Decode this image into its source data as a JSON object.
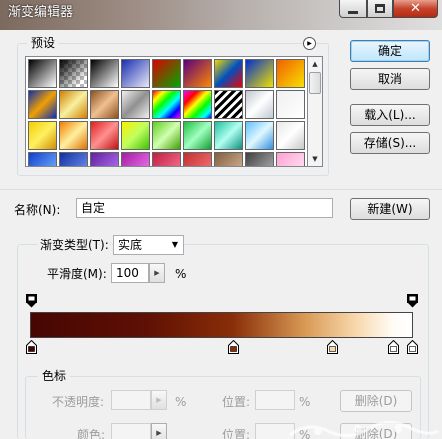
{
  "window": {
    "title": "渐变编辑器",
    "controls": {
      "minimize": "minimize",
      "maximize": "maximize",
      "close": "close"
    }
  },
  "presets": {
    "title": "预设",
    "menu_icon": "flyout-menu-icon",
    "swatches": [
      "#000,#fff",
      "checker",
      "#000,#fff",
      "#1a2fb0,#e8e8f8",
      "#d00,#0a0",
      "#5a0080,#f80",
      "#f0d800,#0050c0,#e00",
      "#0030d0,#f0e000",
      "#f06000,#f8e000",
      "#1030b0,#f0a000,#1030b0",
      "#d08000,#f8f0a0,#d08000",
      "#8c5020,#f0c090,#8c5020",
      "#f0f0f0,#909090,#f0f0f0",
      "rainbow",
      "rainbow2",
      "stripes",
      "#c0c8d0,#fff,#c0c8d0",
      "#f0f0f0,#fff",
      "#f0d000,#fff060,#d09000",
      "#f08000,#fff0a0,#e07000",
      "#e02020,#ff9090,#c01010",
      "#f8f000,#c0ff60,#40c000",
      "#60d020,#d0ffb0,#40a000",
      "#20c040,#a0ffc0,#10a030",
      "#20c0a0,#b0fff0,#109080",
      "#60c0ff,#e0f8ff,#3090e0",
      "#e8e8e8,#fff,#c8c8c8",
      "#1040d0,#80c0ff",
      "#1030a0,#80a0ff",
      "#6020a0,#c080ff",
      "#a020a0,#ff80ff",
      "#c02040,#ff80a0",
      "#c03030,#ff8080",
      "#806040,#e0c0a0",
      "#404040,#c0c0c0",
      "#ffa0d0,#fff0f8"
    ]
  },
  "buttons": {
    "ok": "确定",
    "cancel": "取消",
    "load": "载入(L)...",
    "save": "存储(S)...",
    "new": "新建(W)"
  },
  "name_field": {
    "label": "名称(N):",
    "value": "自定"
  },
  "gradient": {
    "type_label": "渐变类型(T):",
    "type_value": "实底",
    "smoothness_label": "平滑度(M):",
    "smoothness_value": "100",
    "smoothness_unit": "%",
    "color_stops": [
      {
        "position": 0,
        "color": "#470603"
      },
      {
        "position": 53,
        "color": "#8a2e08"
      },
      {
        "position": 79,
        "color": "#f7d7ab"
      },
      {
        "position": 95,
        "color": "#ffffff"
      },
      {
        "position": 100,
        "color": "#ffffff"
      }
    ],
    "opacity_stops": [
      {
        "position": 0
      },
      {
        "position": 100
      }
    ]
  },
  "color_stop_group": {
    "title": "色标",
    "opacity_label": "不透明度:",
    "opacity_unit": "%",
    "location_label": "位置:",
    "location_unit": "%",
    "delete_button": "删除(D)",
    "color_label": "颜色:",
    "location_label_2": "位置:",
    "location_unit_2": "%",
    "delete_button_2": "删除(D)"
  },
  "colors": {
    "accent": "#3c7fb1",
    "titlebar": "#7c6a5e",
    "close": "#c7432b"
  }
}
